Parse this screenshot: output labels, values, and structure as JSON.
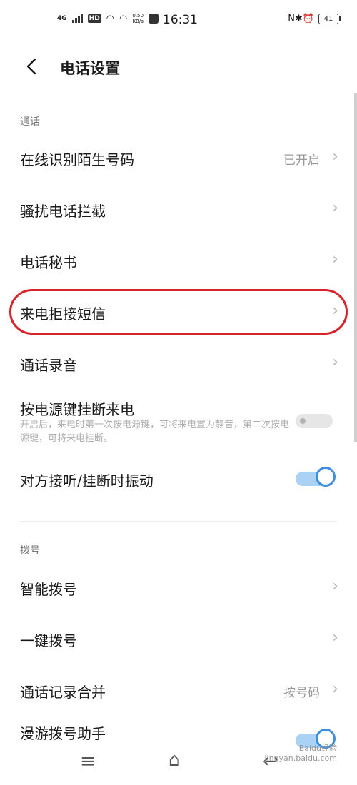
{
  "status_bar": {
    "network": "4G",
    "hd": "HD",
    "speed_value": "0.50",
    "speed_unit": "KB/s",
    "time": "16:31",
    "right_icons": "N✱⏰",
    "battery": "41"
  },
  "header": {
    "back_icon": "chevron-left-icon",
    "title": "电话设置"
  },
  "sections": {
    "call": {
      "label": "通话"
    },
    "dial": {
      "label": "拨号"
    }
  },
  "rows": {
    "online_id": {
      "label": "在线识别陌生号码",
      "value": "已开启"
    },
    "harass_block": {
      "label": "骚扰电话拦截"
    },
    "secretary": {
      "label": "电话秘书"
    },
    "reject_sms": {
      "label": "来电拒接短信"
    },
    "recording": {
      "label": "通话录音"
    },
    "power_hangup": {
      "label": "按电源键挂断来电",
      "description": "开启后，来电时第一次按电源键，可将来电置为静音，第二次按电源键，可将来电挂断。",
      "enabled": false
    },
    "vibrate": {
      "label": "对方接听/挂断时振动",
      "enabled": true
    },
    "smart_dial": {
      "label": "智能拨号"
    },
    "one_key_dial": {
      "label": "一键拨号"
    },
    "merge_log": {
      "label": "通话记录合并",
      "value": "按号码"
    },
    "roaming": {
      "label": "漫游拨号助手",
      "enabled": true
    }
  },
  "chevron": "›",
  "nav": {
    "menu_icon": "≡",
    "home_icon": "⌂",
    "back_icon": "↩"
  },
  "watermark": {
    "line1": "Baidu经验",
    "line2": "jingyan.baidu.com"
  },
  "colors": {
    "accent": "#3d8ede",
    "highlight": "#d9232a"
  }
}
